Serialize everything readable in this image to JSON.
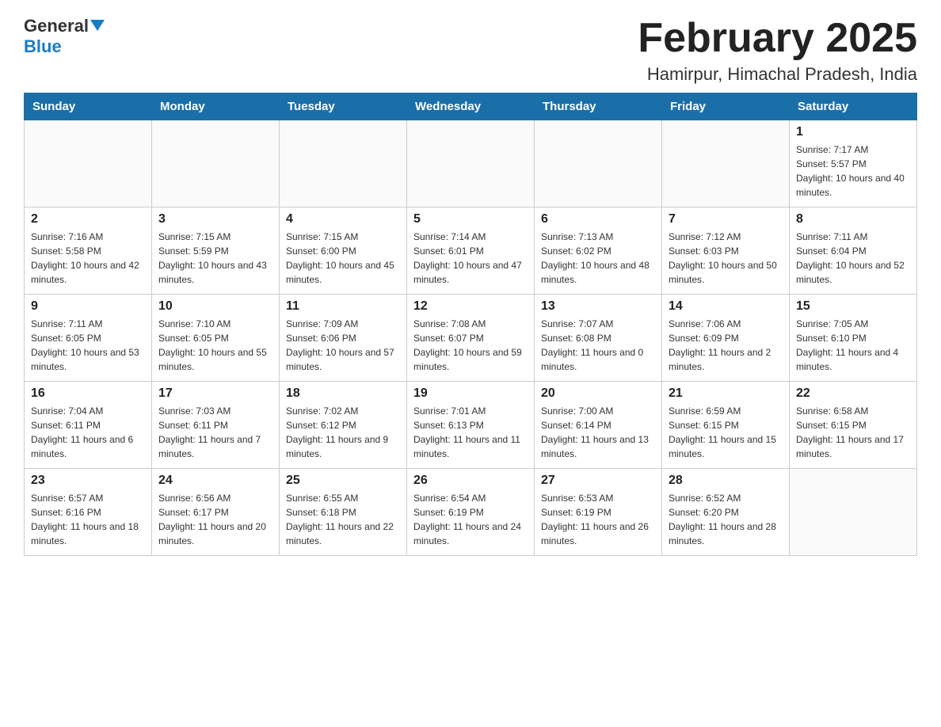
{
  "header": {
    "logo_general": "General",
    "logo_blue": "Blue",
    "month_title": "February 2025",
    "location": "Hamirpur, Himachal Pradesh, India"
  },
  "days_of_week": [
    "Sunday",
    "Monday",
    "Tuesday",
    "Wednesday",
    "Thursday",
    "Friday",
    "Saturday"
  ],
  "weeks": [
    [
      {
        "day": "",
        "info": ""
      },
      {
        "day": "",
        "info": ""
      },
      {
        "day": "",
        "info": ""
      },
      {
        "day": "",
        "info": ""
      },
      {
        "day": "",
        "info": ""
      },
      {
        "day": "",
        "info": ""
      },
      {
        "day": "1",
        "info": "Sunrise: 7:17 AM\nSunset: 5:57 PM\nDaylight: 10 hours and 40 minutes."
      }
    ],
    [
      {
        "day": "2",
        "info": "Sunrise: 7:16 AM\nSunset: 5:58 PM\nDaylight: 10 hours and 42 minutes."
      },
      {
        "day": "3",
        "info": "Sunrise: 7:15 AM\nSunset: 5:59 PM\nDaylight: 10 hours and 43 minutes."
      },
      {
        "day": "4",
        "info": "Sunrise: 7:15 AM\nSunset: 6:00 PM\nDaylight: 10 hours and 45 minutes."
      },
      {
        "day": "5",
        "info": "Sunrise: 7:14 AM\nSunset: 6:01 PM\nDaylight: 10 hours and 47 minutes."
      },
      {
        "day": "6",
        "info": "Sunrise: 7:13 AM\nSunset: 6:02 PM\nDaylight: 10 hours and 48 minutes."
      },
      {
        "day": "7",
        "info": "Sunrise: 7:12 AM\nSunset: 6:03 PM\nDaylight: 10 hours and 50 minutes."
      },
      {
        "day": "8",
        "info": "Sunrise: 7:11 AM\nSunset: 6:04 PM\nDaylight: 10 hours and 52 minutes."
      }
    ],
    [
      {
        "day": "9",
        "info": "Sunrise: 7:11 AM\nSunset: 6:05 PM\nDaylight: 10 hours and 53 minutes."
      },
      {
        "day": "10",
        "info": "Sunrise: 7:10 AM\nSunset: 6:05 PM\nDaylight: 10 hours and 55 minutes."
      },
      {
        "day": "11",
        "info": "Sunrise: 7:09 AM\nSunset: 6:06 PM\nDaylight: 10 hours and 57 minutes."
      },
      {
        "day": "12",
        "info": "Sunrise: 7:08 AM\nSunset: 6:07 PM\nDaylight: 10 hours and 59 minutes."
      },
      {
        "day": "13",
        "info": "Sunrise: 7:07 AM\nSunset: 6:08 PM\nDaylight: 11 hours and 0 minutes."
      },
      {
        "day": "14",
        "info": "Sunrise: 7:06 AM\nSunset: 6:09 PM\nDaylight: 11 hours and 2 minutes."
      },
      {
        "day": "15",
        "info": "Sunrise: 7:05 AM\nSunset: 6:10 PM\nDaylight: 11 hours and 4 minutes."
      }
    ],
    [
      {
        "day": "16",
        "info": "Sunrise: 7:04 AM\nSunset: 6:11 PM\nDaylight: 11 hours and 6 minutes."
      },
      {
        "day": "17",
        "info": "Sunrise: 7:03 AM\nSunset: 6:11 PM\nDaylight: 11 hours and 7 minutes."
      },
      {
        "day": "18",
        "info": "Sunrise: 7:02 AM\nSunset: 6:12 PM\nDaylight: 11 hours and 9 minutes."
      },
      {
        "day": "19",
        "info": "Sunrise: 7:01 AM\nSunset: 6:13 PM\nDaylight: 11 hours and 11 minutes."
      },
      {
        "day": "20",
        "info": "Sunrise: 7:00 AM\nSunset: 6:14 PM\nDaylight: 11 hours and 13 minutes."
      },
      {
        "day": "21",
        "info": "Sunrise: 6:59 AM\nSunset: 6:15 PM\nDaylight: 11 hours and 15 minutes."
      },
      {
        "day": "22",
        "info": "Sunrise: 6:58 AM\nSunset: 6:15 PM\nDaylight: 11 hours and 17 minutes."
      }
    ],
    [
      {
        "day": "23",
        "info": "Sunrise: 6:57 AM\nSunset: 6:16 PM\nDaylight: 11 hours and 18 minutes."
      },
      {
        "day": "24",
        "info": "Sunrise: 6:56 AM\nSunset: 6:17 PM\nDaylight: 11 hours and 20 minutes."
      },
      {
        "day": "25",
        "info": "Sunrise: 6:55 AM\nSunset: 6:18 PM\nDaylight: 11 hours and 22 minutes."
      },
      {
        "day": "26",
        "info": "Sunrise: 6:54 AM\nSunset: 6:19 PM\nDaylight: 11 hours and 24 minutes."
      },
      {
        "day": "27",
        "info": "Sunrise: 6:53 AM\nSunset: 6:19 PM\nDaylight: 11 hours and 26 minutes."
      },
      {
        "day": "28",
        "info": "Sunrise: 6:52 AM\nSunset: 6:20 PM\nDaylight: 11 hours and 28 minutes."
      },
      {
        "day": "",
        "info": ""
      }
    ]
  ]
}
